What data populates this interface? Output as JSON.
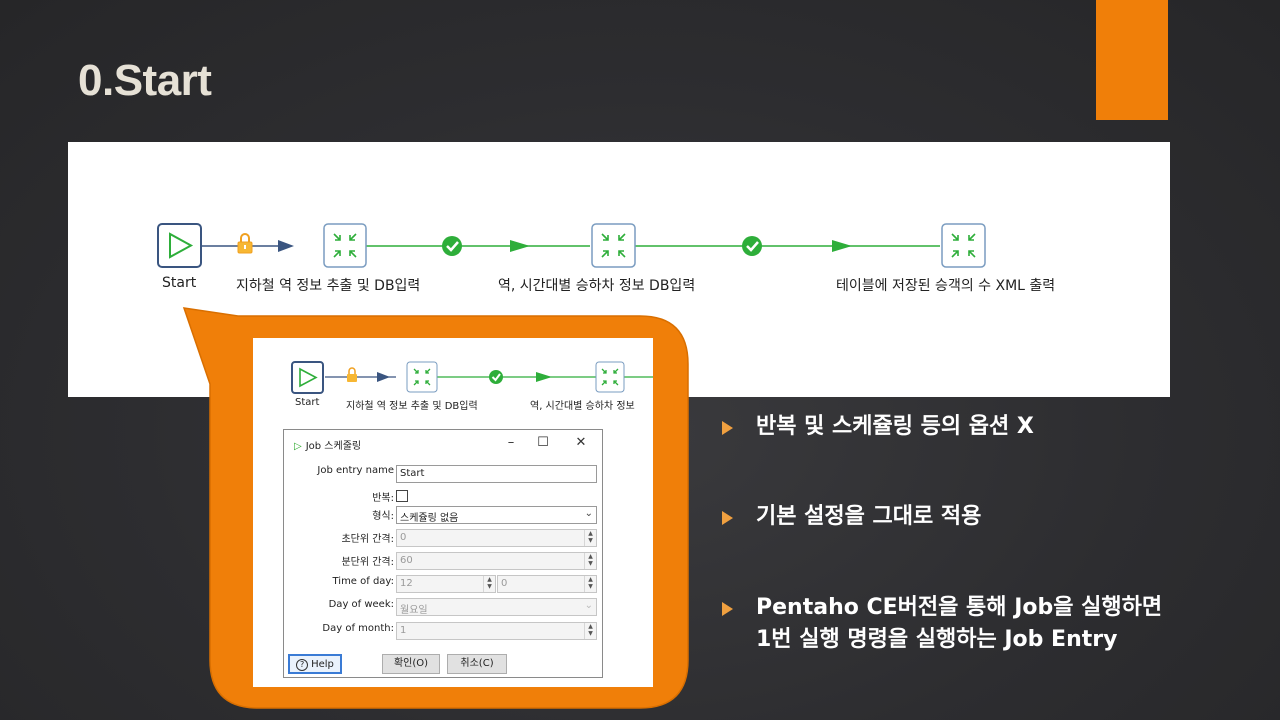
{
  "slide": {
    "title": "0.Start",
    "accent_color": "#f07f09"
  },
  "flow": {
    "steps": [
      {
        "label": "Start",
        "icon": "start-play-icon"
      },
      {
        "label": "지하철 역 정보 추출 및 DB입력",
        "icon": "transformation-icon"
      },
      {
        "label": "역, 시간대별 승하차 정보 DB입력",
        "icon": "transformation-icon"
      },
      {
        "label": "테이블에 저장된 승객의 수 XML 출력",
        "icon": "transformation-icon"
      }
    ],
    "hop_icons": [
      "lock-icon",
      "success-check-icon",
      "success-check-icon"
    ]
  },
  "inset": {
    "start_label": "Start",
    "step1_label": "지하철 역 정보 추출 및 DB입력",
    "step2_label": "역, 시간대별 승하차 정보"
  },
  "dialog": {
    "title": "Job 스케줄링",
    "fields": {
      "job_entry_name": {
        "label": "Job entry name",
        "value": "Start"
      },
      "repeat": {
        "label": "반복:"
      },
      "type": {
        "label": "형식:",
        "value": "스케쥴링 없음"
      },
      "seconds_interval": {
        "label": "초단위 간격:",
        "value": "0"
      },
      "minutes_interval": {
        "label": "분단위 간격:",
        "value": "60"
      },
      "time_of_day": {
        "label": "Time of day:",
        "hour": "12",
        "minute": "0"
      },
      "day_of_week": {
        "label": "Day of week:",
        "value": "월요일"
      },
      "day_of_month": {
        "label": "Day of month:",
        "value": "1"
      }
    },
    "buttons": {
      "help": "Help",
      "ok": "확인(O)",
      "cancel": "취소(C)"
    }
  },
  "bullets": [
    {
      "lines": [
        "반복 및 스케쥴링 등의 옵션 X"
      ]
    },
    {
      "lines": [
        "기본 설정을 그대로 적용"
      ]
    },
    {
      "lines": [
        "Pentaho CE버전을 통해 Job을 실행하면",
        "1번 실행 명령을 실행하는 Job Entry"
      ]
    }
  ]
}
